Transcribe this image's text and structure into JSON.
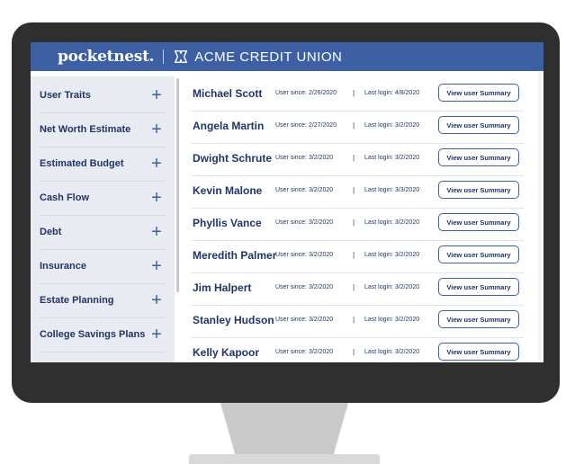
{
  "header": {
    "brand": "pocketnest.",
    "separator": "|",
    "credit_union": "ACME CREDIT UNION",
    "bg_color": "#3d5fa3"
  },
  "sidebar": {
    "items": [
      {
        "label": "User Traits",
        "icon": "plus-icon"
      },
      {
        "label": "Net Worth Estimate",
        "icon": "plus-icon"
      },
      {
        "label": "Estimated Budget",
        "icon": "plus-icon"
      },
      {
        "label": "Cash Flow",
        "icon": "plus-icon"
      },
      {
        "label": "Debt",
        "icon": "plus-icon"
      },
      {
        "label": "Insurance",
        "icon": "plus-icon"
      },
      {
        "label": "Estate Planning",
        "icon": "plus-icon"
      },
      {
        "label": "College Savings Plans",
        "icon": "plus-icon"
      }
    ],
    "plus_glyph": "+"
  },
  "users": [
    {
      "name": "Michael Scott",
      "since": "User since: 2/26/2020",
      "login": "Last login: 4/8/2020",
      "button": "View user Summary"
    },
    {
      "name": "Angela Martin",
      "since": "User since: 2/27/2020",
      "login": "Last login: 3/2/2020",
      "button": "View user Summary"
    },
    {
      "name": "Dwight Schrute",
      "since": "User since: 3/2/2020",
      "login": "Last login: 3/2/2020",
      "button": "View user Summary"
    },
    {
      "name": "Kevin Malone",
      "since": "User since: 3/2/2020",
      "login": "Last login: 3/3/2020",
      "button": "View user Summary"
    },
    {
      "name": "Phyllis Vance",
      "since": "User since: 3/2/2020",
      "login": "Last login: 3/2/2020",
      "button": "View user Summary"
    },
    {
      "name": "Meredith Palmer",
      "since": "User since: 3/2/2020",
      "login": "Last login: 3/2/2020",
      "button": "View user Summary"
    },
    {
      "name": "Jim Halpert",
      "since": "User since: 3/2/2020",
      "login": "Last login: 3/2/2020",
      "button": "View user Summary"
    },
    {
      "name": "Stanley Hudson",
      "since": "User since: 3/2/2020",
      "login": "Last login: 3/2/2020",
      "button": "View user Summary"
    },
    {
      "name": "Kelly Kapoor",
      "since": "User since: 3/2/2020",
      "login": "Last login: 3/2/2020",
      "button": "View user Summary"
    }
  ],
  "row_separator": "|"
}
